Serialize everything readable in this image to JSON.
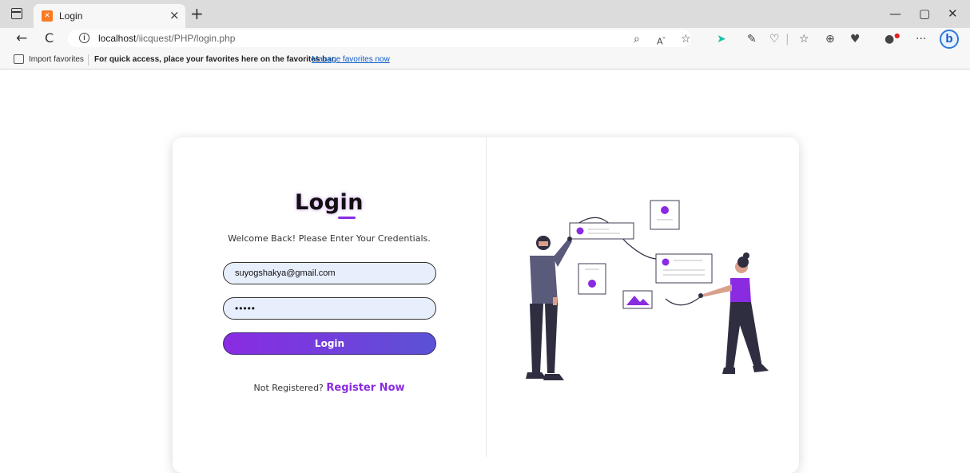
{
  "browser": {
    "tab": {
      "title": "Login",
      "close": "×",
      "new_tab": "+"
    },
    "window_controls": {
      "minimize": "—",
      "restore": "▢",
      "close": "✕"
    },
    "nav": {
      "back": "←",
      "reload": "C",
      "info": "i"
    },
    "url": {
      "host": "localhost",
      "path": "/iicquest/PHP/login.php"
    },
    "toolbar_icons": [
      "read-aloud-icon",
      "favorite-star-icon",
      "extension-icon",
      "draw-icon",
      "performance-icon",
      "favorites-list-icon",
      "collections-icon",
      "browser-essentials-icon",
      "profile-icon",
      "more-icon",
      "bing-icon"
    ],
    "favorites_bar": {
      "import_label": "Import favorites",
      "message": "For quick access, place your favorites here on the favorites bar.",
      "link": "Manage favorites now"
    }
  },
  "login": {
    "title": "Login",
    "subtitle": "Welcome Back! Please Enter Your Credentials.",
    "email_value": "suyogshakya@gmail.com",
    "password_value": "•••••",
    "button_label": "Login",
    "register_prompt": "Not Registered?",
    "register_link": "Register Now"
  },
  "colors": {
    "accent": "#8a2be2",
    "accent_end": "#5b52d6",
    "field_bg": "#e8effc",
    "illustration_dark": "#2f2e41",
    "illustration_purple": "#8a2be2"
  }
}
